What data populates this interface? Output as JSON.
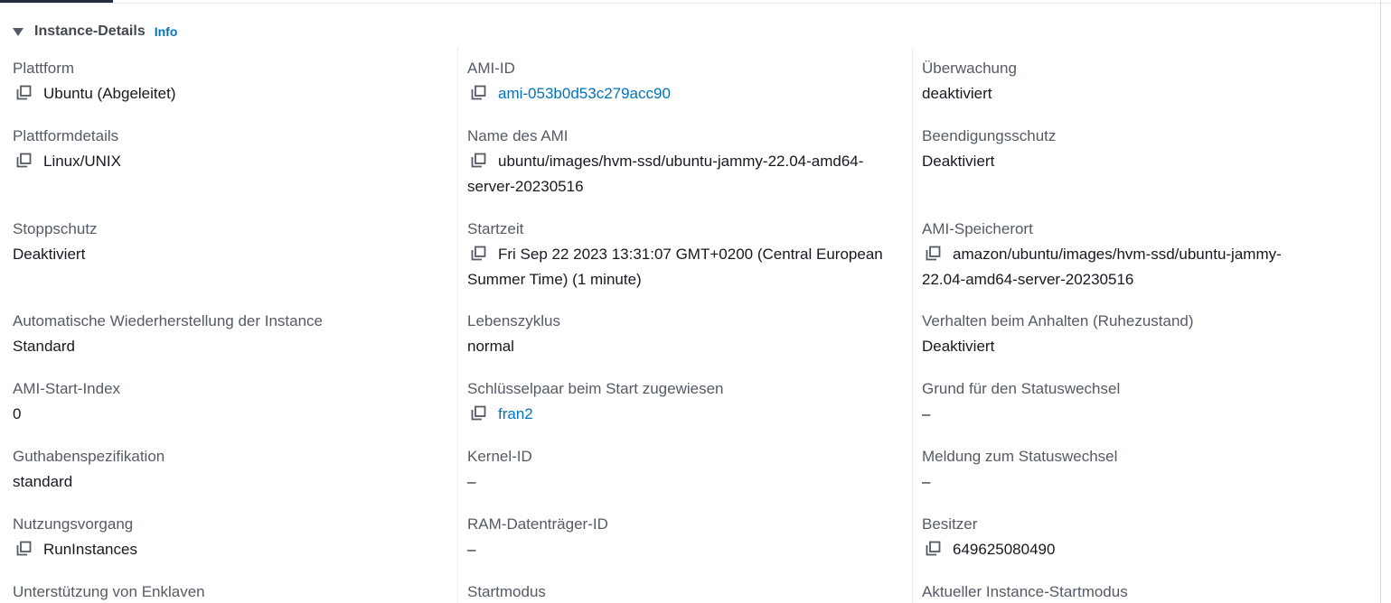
{
  "section": {
    "title": "Instance-Details",
    "info_link": "Info"
  },
  "icons": {
    "collapse": "caret-down-icon",
    "copy": "copy-icon"
  },
  "colors": {
    "link": "#0073bb",
    "label": "#545b64",
    "value": "#16191f"
  },
  "columns": [
    [
      {
        "label": "Plattform",
        "value": "Ubuntu (Abgeleitet)",
        "copy": true,
        "link": false
      },
      {
        "label": "Plattformdetails",
        "value": "Linux/UNIX",
        "copy": true,
        "link": false
      },
      {
        "label": "Stoppschutz",
        "value": "Deaktiviert",
        "copy": false,
        "link": false
      },
      {
        "label": "Automatische Wiederherstellung der Instance",
        "value": "Standard",
        "copy": false,
        "link": false
      },
      {
        "label": "AMI-Start-Index",
        "value": "0",
        "copy": false,
        "link": false
      },
      {
        "label": "Guthabenspezifikation",
        "value": "standard",
        "copy": false,
        "link": false
      },
      {
        "label": "Nutzungsvorgang",
        "value": "RunInstances",
        "copy": true,
        "link": false
      },
      {
        "label": "Unterstützung von Enklaven",
        "value": "",
        "copy": false,
        "link": false
      }
    ],
    [
      {
        "label": "AMI-ID",
        "value": "ami-053b0d53c279acc90",
        "copy": true,
        "link": true
      },
      {
        "label": "Name des AMI",
        "value": "ubuntu/images/hvm-ssd/ubuntu-jammy-22.04-amd64-server-20230516",
        "copy": true,
        "link": false
      },
      {
        "label": "Startzeit",
        "value": "Fri Sep 22 2023 13:31:07 GMT+0200 (Central European Summer Time) (1 minute)",
        "copy": true,
        "link": false
      },
      {
        "label": "Lebenszyklus",
        "value": "normal",
        "copy": false,
        "link": false
      },
      {
        "label": "Schlüsselpaar beim Start zugewiesen",
        "value": "fran2",
        "copy": true,
        "link": true
      },
      {
        "label": "Kernel-ID",
        "value": "–",
        "copy": false,
        "link": false
      },
      {
        "label": "RAM-Datenträger-ID",
        "value": "–",
        "copy": false,
        "link": false
      },
      {
        "label": "Startmodus",
        "value": "",
        "copy": false,
        "link": false
      }
    ],
    [
      {
        "label": "Überwachung",
        "value": "deaktiviert",
        "copy": false,
        "link": false
      },
      {
        "label": "Beendigungsschutz",
        "value": "Deaktiviert",
        "copy": false,
        "link": false
      },
      {
        "label": "AMI-Speicherort",
        "value": "amazon/ubuntu/images/hvm-ssd/ubuntu-jammy-22.04-amd64-server-20230516",
        "copy": true,
        "link": false
      },
      {
        "label": "Verhalten beim Anhalten (Ruhezustand)",
        "value": "Deaktiviert",
        "copy": false,
        "link": false
      },
      {
        "label": "Grund für den Statuswechsel",
        "value": "–",
        "copy": false,
        "link": false
      },
      {
        "label": "Meldung zum Statuswechsel",
        "value": "–",
        "copy": false,
        "link": false
      },
      {
        "label": "Besitzer",
        "value": "649625080490",
        "copy": true,
        "link": false
      },
      {
        "label": "Aktueller Instance-Startmodus",
        "value": "",
        "copy": false,
        "link": false
      }
    ]
  ]
}
